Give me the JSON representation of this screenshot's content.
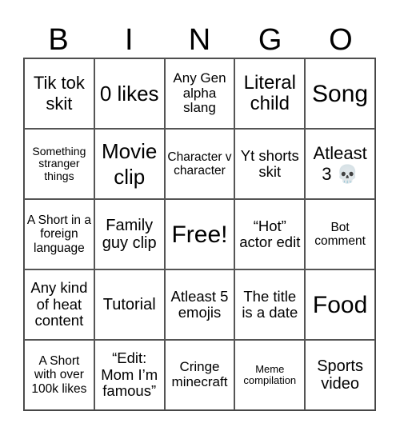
{
  "title_letters": [
    "B",
    "I",
    "N",
    "G",
    "O"
  ],
  "cells": [
    "Tik tok skit",
    "0 likes",
    "Any Gen alpha slang",
    "Literal child",
    "Song",
    "Something stranger things",
    "Movie clip",
    "Character v character",
    "Yt shorts skit",
    "Atleast 3 💀",
    "A Short in a foreign language",
    "Family guy clip",
    "Free!",
    "“Hot” actor edit",
    "Bot comment",
    "Any kind of heat content",
    "Tutorial",
    "Atleast 5 emojis",
    "The title is a date",
    "Food",
    "A Short with over 100k likes",
    "“Edit: Mom I’m famous”",
    "Cringe minecraft",
    "Meme compilation",
    "Sports video"
  ]
}
